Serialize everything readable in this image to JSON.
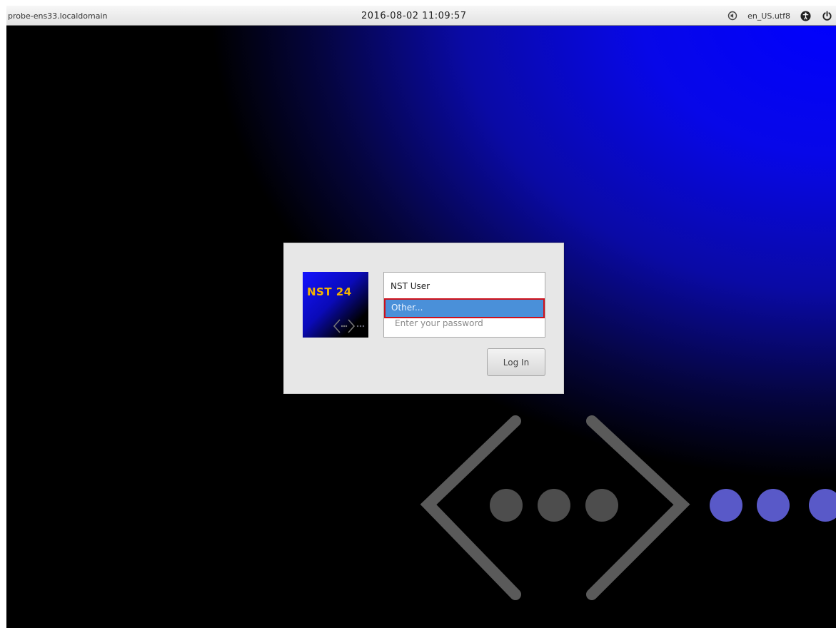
{
  "topbar": {
    "hostname": "probe-ens33.localdomain",
    "clock": "2016-08-02 11:09:57",
    "locale": "en_US.utf8",
    "icons": [
      "audio-icon",
      "accessibility-icon",
      "power-icon"
    ]
  },
  "login": {
    "logo_text": "NST 24",
    "users": [
      {
        "label": "NST User"
      },
      {
        "label": "Other..."
      }
    ],
    "password_placeholder": "Enter your password",
    "login_button": "Log In",
    "highlight_color": "#d0101a",
    "selection_color": "#4a90d9"
  },
  "background": {
    "colors": [
      "#0000ff",
      "#000000"
    ],
    "watermark": "nst-logo-watermark"
  }
}
